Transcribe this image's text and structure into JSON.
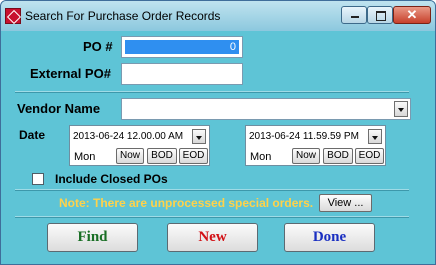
{
  "window": {
    "title": "Search For Purchase Order Records",
    "close_glyph": "✕"
  },
  "form": {
    "po_label": "PO #",
    "po_value": "0",
    "external_po_label": "External PO#",
    "external_po_value": "",
    "vendor_label": "Vendor Name",
    "vendor_value": "",
    "date_label": "Date",
    "start_date": {
      "value": "2013-06-24 12.00.00 AM",
      "day": "Mon"
    },
    "end_date": {
      "value": "2013-06-24 11.59.59 PM",
      "day": "Mon"
    },
    "now_label": "Now",
    "bod_label": "BOD",
    "eod_label": "EOD",
    "include_closed_label": "Include Closed POs",
    "include_closed_checked": false
  },
  "note": {
    "text": "Note: There are unprocessed special orders.",
    "view_label": "View ..."
  },
  "actions": {
    "find_label": "Find",
    "new_label": "New",
    "done_label": "Done"
  },
  "colors": {
    "background": "#5ec4d6",
    "note": "#ffd24a",
    "find": "#1a6f25",
    "new": "#d20f14",
    "done": "#1a2fc1",
    "selection": "#2f8ff0"
  }
}
